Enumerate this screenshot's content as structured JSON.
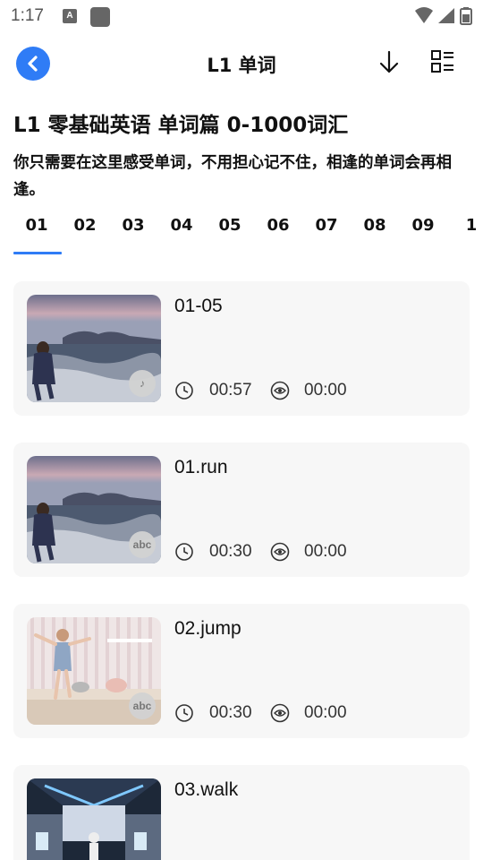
{
  "status": {
    "time": "1:17",
    "a_icon_letter": "A"
  },
  "header": {
    "title": "L1 单词",
    "back_icon": "chevron-left-icon",
    "download_icon": "download-icon",
    "list_icon": "list-icon"
  },
  "course": {
    "title": "L1 零基础英语 单词篇 0-1000词汇",
    "description": "你只需要在这里感受单词，不用担心记不住，相逢的单词会再相逢。"
  },
  "tabs": [
    "01",
    "02",
    "03",
    "04",
    "05",
    "06",
    "07",
    "08",
    "09",
    "1"
  ],
  "active_tab": "01",
  "colors": {
    "accent": "#2f7cf6",
    "card_bg": "#f7f7f7"
  },
  "cards": [
    {
      "title": "01-05",
      "duration": "00:57",
      "watched": "00:00",
      "badge": "music-note-icon",
      "thumb": "beach"
    },
    {
      "title": "01.run",
      "duration": "00:30",
      "watched": "00:00",
      "badge": "abc",
      "thumb": "beach"
    },
    {
      "title": "02.jump",
      "duration": "00:30",
      "watched": "00:00",
      "badge": "abc",
      "thumb": "bedroom"
    },
    {
      "title": "03.walk",
      "badge": "none",
      "thumb": "mall"
    }
  ]
}
